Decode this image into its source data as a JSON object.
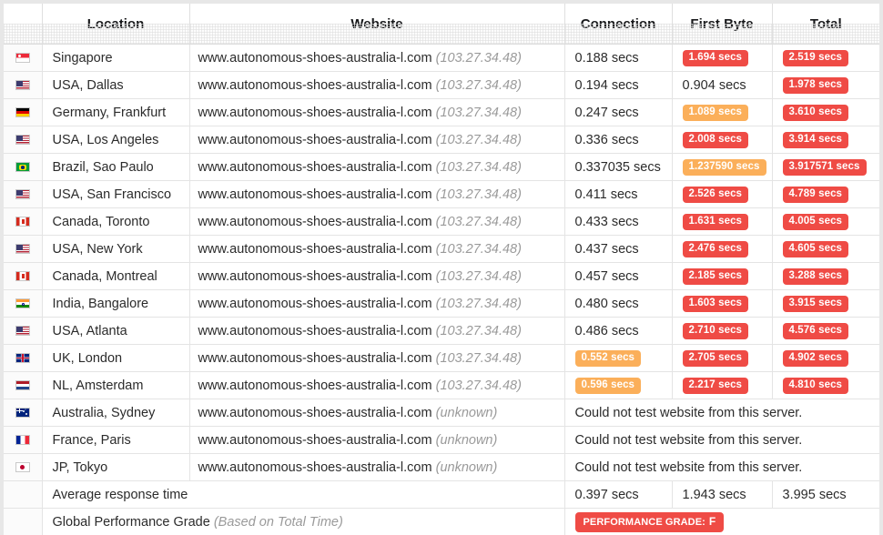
{
  "table": {
    "headers": {
      "flag": "",
      "location": "Location",
      "website": "Website",
      "connection": "Connection",
      "first_byte": "First Byte",
      "total": "Total"
    },
    "rows": [
      {
        "flag_icon": "flag-singapore-icon",
        "flag_class": "flag-sg",
        "location": "Singapore",
        "website": "www.autonomous-shoes-australia-l.com",
        "ip": "(103.27.34.48)",
        "connection": "0.188 secs",
        "connection_badge": "none",
        "first_byte": "1.694 secs",
        "first_byte_badge": "red",
        "total": "2.519 secs",
        "total_badge": "red",
        "error": null
      },
      {
        "flag_icon": "flag-usa-icon",
        "flag_class": "flag-us",
        "location": "USA, Dallas",
        "website": "www.autonomous-shoes-australia-l.com",
        "ip": "(103.27.34.48)",
        "connection": "0.194 secs",
        "connection_badge": "none",
        "first_byte": "0.904 secs",
        "first_byte_badge": "none",
        "total": "1.978 secs",
        "total_badge": "red",
        "error": null
      },
      {
        "flag_icon": "flag-germany-icon",
        "flag_class": "flag-de",
        "location": "Germany, Frankfurt",
        "website": "www.autonomous-shoes-australia-l.com",
        "ip": "(103.27.34.48)",
        "connection": "0.247 secs",
        "connection_badge": "none",
        "first_byte": "1.089 secs",
        "first_byte_badge": "orange",
        "total": "3.610 secs",
        "total_badge": "red",
        "error": null
      },
      {
        "flag_icon": "flag-usa-icon",
        "flag_class": "flag-us",
        "location": "USA, Los Angeles",
        "website": "www.autonomous-shoes-australia-l.com",
        "ip": "(103.27.34.48)",
        "connection": "0.336 secs",
        "connection_badge": "none",
        "first_byte": "2.008 secs",
        "first_byte_badge": "red",
        "total": "3.914 secs",
        "total_badge": "red",
        "error": null
      },
      {
        "flag_icon": "flag-brazil-icon",
        "flag_class": "flag-br",
        "location": "Brazil, Sao Paulo",
        "website": "www.autonomous-shoes-australia-l.com",
        "ip": "(103.27.34.48)",
        "connection": "0.337035 secs",
        "connection_badge": "none",
        "first_byte": "1.237590 secs",
        "first_byte_badge": "orange",
        "total": "3.917571 secs",
        "total_badge": "red",
        "error": null
      },
      {
        "flag_icon": "flag-usa-icon",
        "flag_class": "flag-us",
        "location": "USA, San Francisco",
        "website": "www.autonomous-shoes-australia-l.com",
        "ip": "(103.27.34.48)",
        "connection": "0.411 secs",
        "connection_badge": "none",
        "first_byte": "2.526 secs",
        "first_byte_badge": "red",
        "total": "4.789 secs",
        "total_badge": "red",
        "error": null
      },
      {
        "flag_icon": "flag-canada-icon",
        "flag_class": "flag-ca",
        "location": "Canada, Toronto",
        "website": "www.autonomous-shoes-australia-l.com",
        "ip": "(103.27.34.48)",
        "connection": "0.433 secs",
        "connection_badge": "none",
        "first_byte": "1.631 secs",
        "first_byte_badge": "red",
        "total": "4.005 secs",
        "total_badge": "red",
        "error": null
      },
      {
        "flag_icon": "flag-usa-icon",
        "flag_class": "flag-us",
        "location": "USA, New York",
        "website": "www.autonomous-shoes-australia-l.com",
        "ip": "(103.27.34.48)",
        "connection": "0.437 secs",
        "connection_badge": "none",
        "first_byte": "2.476 secs",
        "first_byte_badge": "red",
        "total": "4.605 secs",
        "total_badge": "red",
        "error": null
      },
      {
        "flag_icon": "flag-canada-icon",
        "flag_class": "flag-ca",
        "location": "Canada, Montreal",
        "website": "www.autonomous-shoes-australia-l.com",
        "ip": "(103.27.34.48)",
        "connection": "0.457 secs",
        "connection_badge": "none",
        "first_byte": "2.185 secs",
        "first_byte_badge": "red",
        "total": "3.288 secs",
        "total_badge": "red",
        "error": null
      },
      {
        "flag_icon": "flag-india-icon",
        "flag_class": "flag-in",
        "location": "India, Bangalore",
        "website": "www.autonomous-shoes-australia-l.com",
        "ip": "(103.27.34.48)",
        "connection": "0.480 secs",
        "connection_badge": "none",
        "first_byte": "1.603 secs",
        "first_byte_badge": "red",
        "total": "3.915 secs",
        "total_badge": "red",
        "error": null
      },
      {
        "flag_icon": "flag-usa-icon",
        "flag_class": "flag-us",
        "location": "USA, Atlanta",
        "website": "www.autonomous-shoes-australia-l.com",
        "ip": "(103.27.34.48)",
        "connection": "0.486 secs",
        "connection_badge": "none",
        "first_byte": "2.710 secs",
        "first_byte_badge": "red",
        "total": "4.576 secs",
        "total_badge": "red",
        "error": null
      },
      {
        "flag_icon": "flag-uk-icon",
        "flag_class": "flag-uk",
        "location": "UK, London",
        "website": "www.autonomous-shoes-australia-l.com",
        "ip": "(103.27.34.48)",
        "connection": "0.552 secs",
        "connection_badge": "orange",
        "first_byte": "2.705 secs",
        "first_byte_badge": "red",
        "total": "4.902 secs",
        "total_badge": "red",
        "error": null
      },
      {
        "flag_icon": "flag-netherlands-icon",
        "flag_class": "flag-nl",
        "location": "NL, Amsterdam",
        "website": "www.autonomous-shoes-australia-l.com",
        "ip": "(103.27.34.48)",
        "connection": "0.596 secs",
        "connection_badge": "orange",
        "first_byte": "2.217 secs",
        "first_byte_badge": "red",
        "total": "4.810 secs",
        "total_badge": "red",
        "error": null
      },
      {
        "flag_icon": "flag-australia-icon",
        "flag_class": "flag-au",
        "location": "Australia, Sydney",
        "website": "www.autonomous-shoes-australia-l.com",
        "ip": "(unknown)",
        "connection": null,
        "connection_badge": "none",
        "first_byte": null,
        "first_byte_badge": "none",
        "total": null,
        "total_badge": "none",
        "error": "Could not test website from this server."
      },
      {
        "flag_icon": "flag-france-icon",
        "flag_class": "flag-fr",
        "location": "France, Paris",
        "website": "www.autonomous-shoes-australia-l.com",
        "ip": "(unknown)",
        "connection": null,
        "connection_badge": "none",
        "first_byte": null,
        "first_byte_badge": "none",
        "total": null,
        "total_badge": "none",
        "error": "Could not test website from this server."
      },
      {
        "flag_icon": "flag-japan-icon",
        "flag_class": "flag-jp",
        "location": "JP, Tokyo",
        "website": "www.autonomous-shoes-australia-l.com",
        "ip": "(unknown)",
        "connection": null,
        "connection_badge": "none",
        "first_byte": null,
        "first_byte_badge": "none",
        "total": null,
        "total_badge": "none",
        "error": "Could not test website from this server."
      }
    ],
    "summary": {
      "average_label": "Average response time",
      "average_connection": "0.397 secs",
      "average_first_byte": "1.943 secs",
      "average_total": "3.995 secs",
      "grade_label": "Global Performance Grade",
      "grade_note": "(Based on Total Time)",
      "grade_badge_label": "PERFORMANCE GRADE:",
      "grade_letter": "F"
    }
  },
  "colors": {
    "badge_red": "#ef4b45",
    "badge_orange": "#fbaf5a",
    "page_background": "#e7e7e7",
    "border": "#e4e4e4",
    "muted_text": "#9a9a9a"
  }
}
